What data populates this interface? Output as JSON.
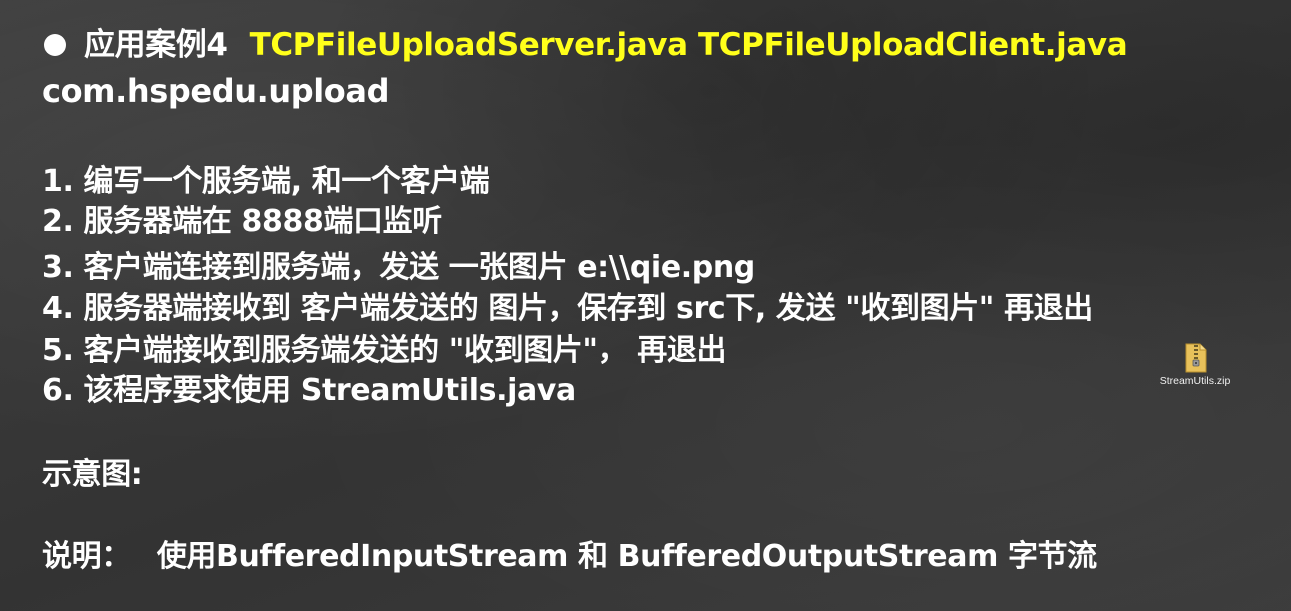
{
  "title": {
    "heading": "应用案例4",
    "files": "TCPFileUploadServer.java TCPFileUploadClient.java",
    "package": "com.hspedu.upload"
  },
  "steps": [
    "1. 编写一个服务端, 和一个客户端",
    "2. 服务器端在 8888端口监听",
    "3. 客户端连接到服务端，发送 一张图片 e:\\\\qie.png",
    "4. 服务器端接收到 客户端发送的 图片，保存到 src下, 发送 \"收到图片\" 再退出",
    "5. 客户端接收到服务端发送的 \"收到图片\"， 再退出",
    "6. 该程序要求使用 StreamUtils.java"
  ],
  "diagram_label": "示意图:",
  "note": {
    "label": "说明：",
    "text": "使用BufferedInputStream 和 BufferedOutputStream 字节流"
  },
  "attachment": {
    "filename": "StreamUtils.zip",
    "icon": "zip-archive-icon"
  },
  "colors": {
    "background": "#3a3a3a",
    "text": "#ffffff",
    "highlight": "#ffff1a"
  }
}
